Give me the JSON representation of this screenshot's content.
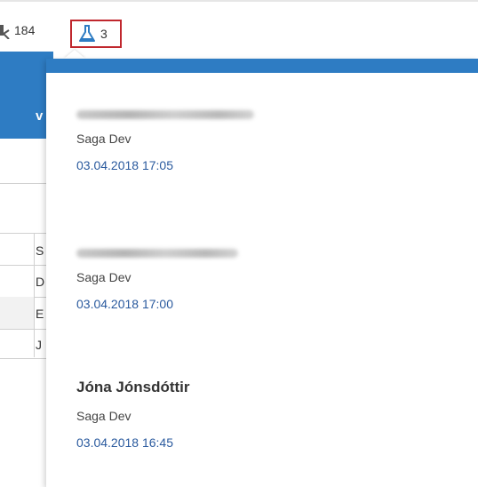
{
  "toolbar": {
    "item1_count": "184",
    "item1_icon": "key-icon",
    "item2_count": "3",
    "item2_icon": "flask-icon",
    "accent": "#c0272d"
  },
  "header": {
    "letter": "v",
    "color": "#2e7cc3"
  },
  "background_cells": [
    "S",
    "D",
    "E",
    "J"
  ],
  "popover": {
    "entries": [
      {
        "name": "",
        "company": "Saga Dev",
        "time": "03.04.2018 17:05"
      },
      {
        "name": "",
        "company": "Saga Dev",
        "time": "03.04.2018 17:00"
      },
      {
        "name": "Jóna Jónsdóttir",
        "company": "Saga Dev",
        "time": "03.04.2018 16:45"
      }
    ],
    "time_color": "#2a5a9e"
  }
}
